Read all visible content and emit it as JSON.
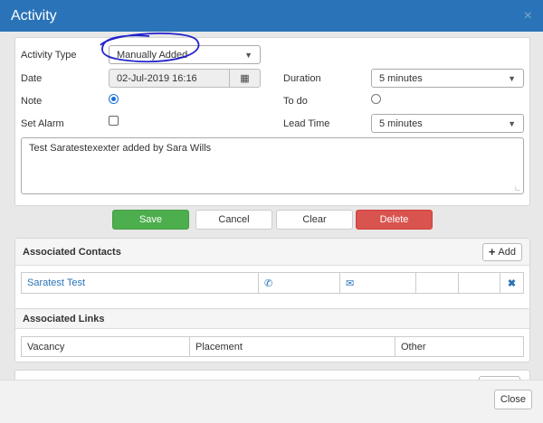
{
  "modal": {
    "title": "Activity",
    "close_glyph": "×"
  },
  "form": {
    "activity_type_label": "Activity Type",
    "activity_type_value": "Manually Added",
    "date_label": "Date",
    "date_value": "02-Jul-2019 16:16",
    "duration_label": "Duration",
    "duration_value": "5 minutes",
    "note_label": "Note",
    "todo_label": "To do",
    "set_alarm_label": "Set Alarm",
    "lead_time_label": "Lead Time",
    "lead_time_value": "5 minutes",
    "note_text": "Test Saratestexexter added by Sara Wills"
  },
  "actions": {
    "save": "Save",
    "cancel": "Cancel",
    "clear": "Clear",
    "delete": "Delete"
  },
  "contacts": {
    "heading": "Associated Contacts",
    "add_label": "Add",
    "rows": [
      {
        "name": "Saratest Test"
      }
    ]
  },
  "links": {
    "heading": "Associated Links",
    "columns": [
      "Vacancy",
      "Placement",
      "Other"
    ]
  },
  "footer": {
    "close_label": "Close"
  },
  "icons": {
    "calendar": "calendar-icon",
    "phone": "phone-icon",
    "email": "envelope-icon",
    "remove": "remove-icon",
    "add": "plus-icon"
  },
  "colors": {
    "header": "#2a73b8",
    "save": "#4cae4c",
    "delete": "#d9534f",
    "annotation": "#2222cc"
  }
}
